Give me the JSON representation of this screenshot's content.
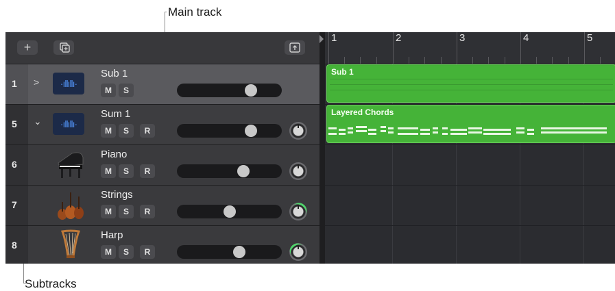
{
  "callouts": {
    "main_track": "Main track",
    "subtracks": "Subtracks"
  },
  "toolbar": {
    "add_icon": "plus-icon",
    "duplicate_icon": "duplicate-icon",
    "upload_icon": "tray-up-icon"
  },
  "ruler": {
    "bars": [
      "1",
      "2",
      "3",
      "4",
      "5"
    ]
  },
  "tracks": [
    {
      "number": "1",
      "name": "Sub 1",
      "buttons": [
        "M",
        "S"
      ],
      "icon": "audio-waveform-icon",
      "disclosure": ">",
      "volume": 0.72
    },
    {
      "number": "5",
      "name": "Sum 1",
      "buttons": [
        "M",
        "S",
        "R"
      ],
      "icon": "audio-waveform-icon",
      "disclosure": "⌄",
      "volume": 0.72
    },
    {
      "number": "6",
      "name": "Piano",
      "buttons": [
        "M",
        "S",
        "R"
      ],
      "icon": "grand-piano-icon",
      "volume": 0.65
    },
    {
      "number": "7",
      "name": "Strings",
      "buttons": [
        "M",
        "S",
        "R"
      ],
      "icon": "cello-icon",
      "volume": 0.5
    },
    {
      "number": "8",
      "name": "Harp",
      "buttons": [
        "M",
        "S",
        "R"
      ],
      "icon": "harp-icon",
      "volume": 0.6
    }
  ],
  "regions": [
    {
      "name": "Sub 1",
      "color": "#45b338"
    },
    {
      "name": "Layered Chords",
      "color": "#45b338"
    }
  ]
}
